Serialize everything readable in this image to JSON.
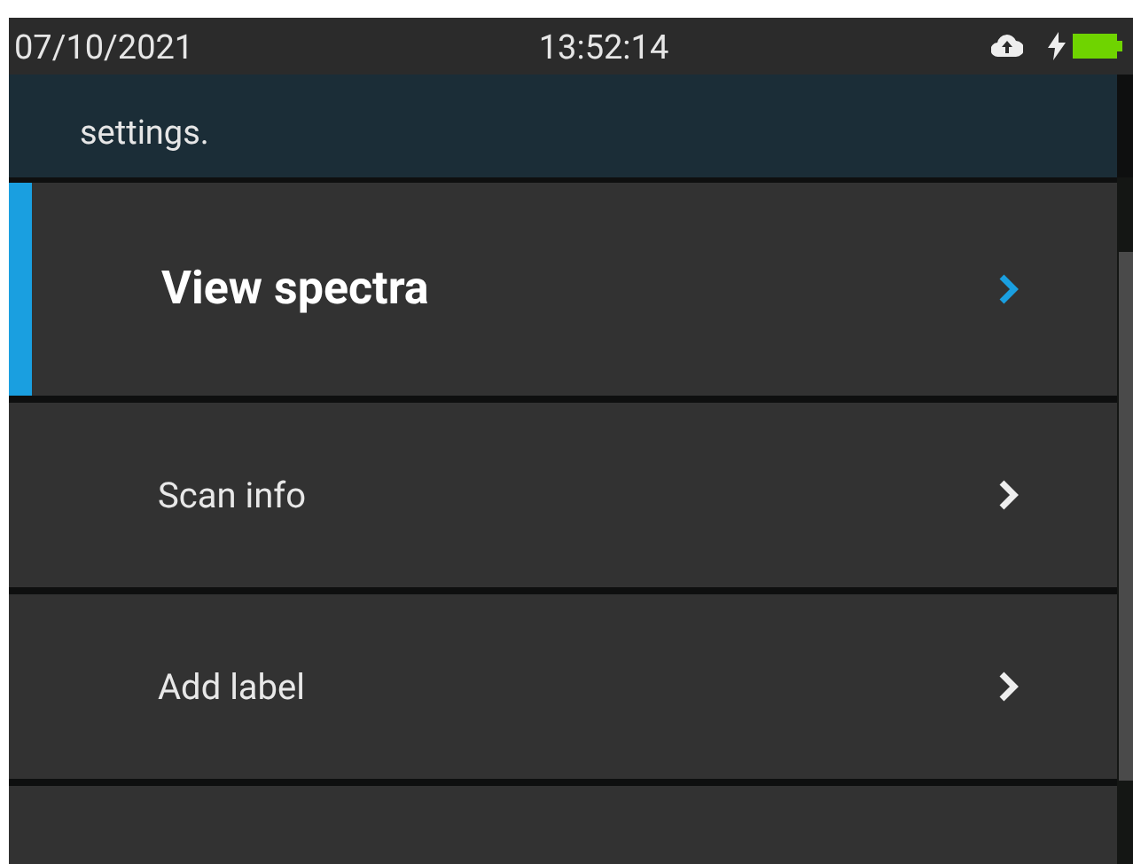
{
  "status_bar": {
    "date": "07/10/2021",
    "time": "13:52:14"
  },
  "banner": {
    "text": "settings."
  },
  "menu": [
    {
      "label": "View spectra",
      "selected": true
    },
    {
      "label": "Scan info",
      "selected": false
    },
    {
      "label": "Add label",
      "selected": false
    }
  ]
}
